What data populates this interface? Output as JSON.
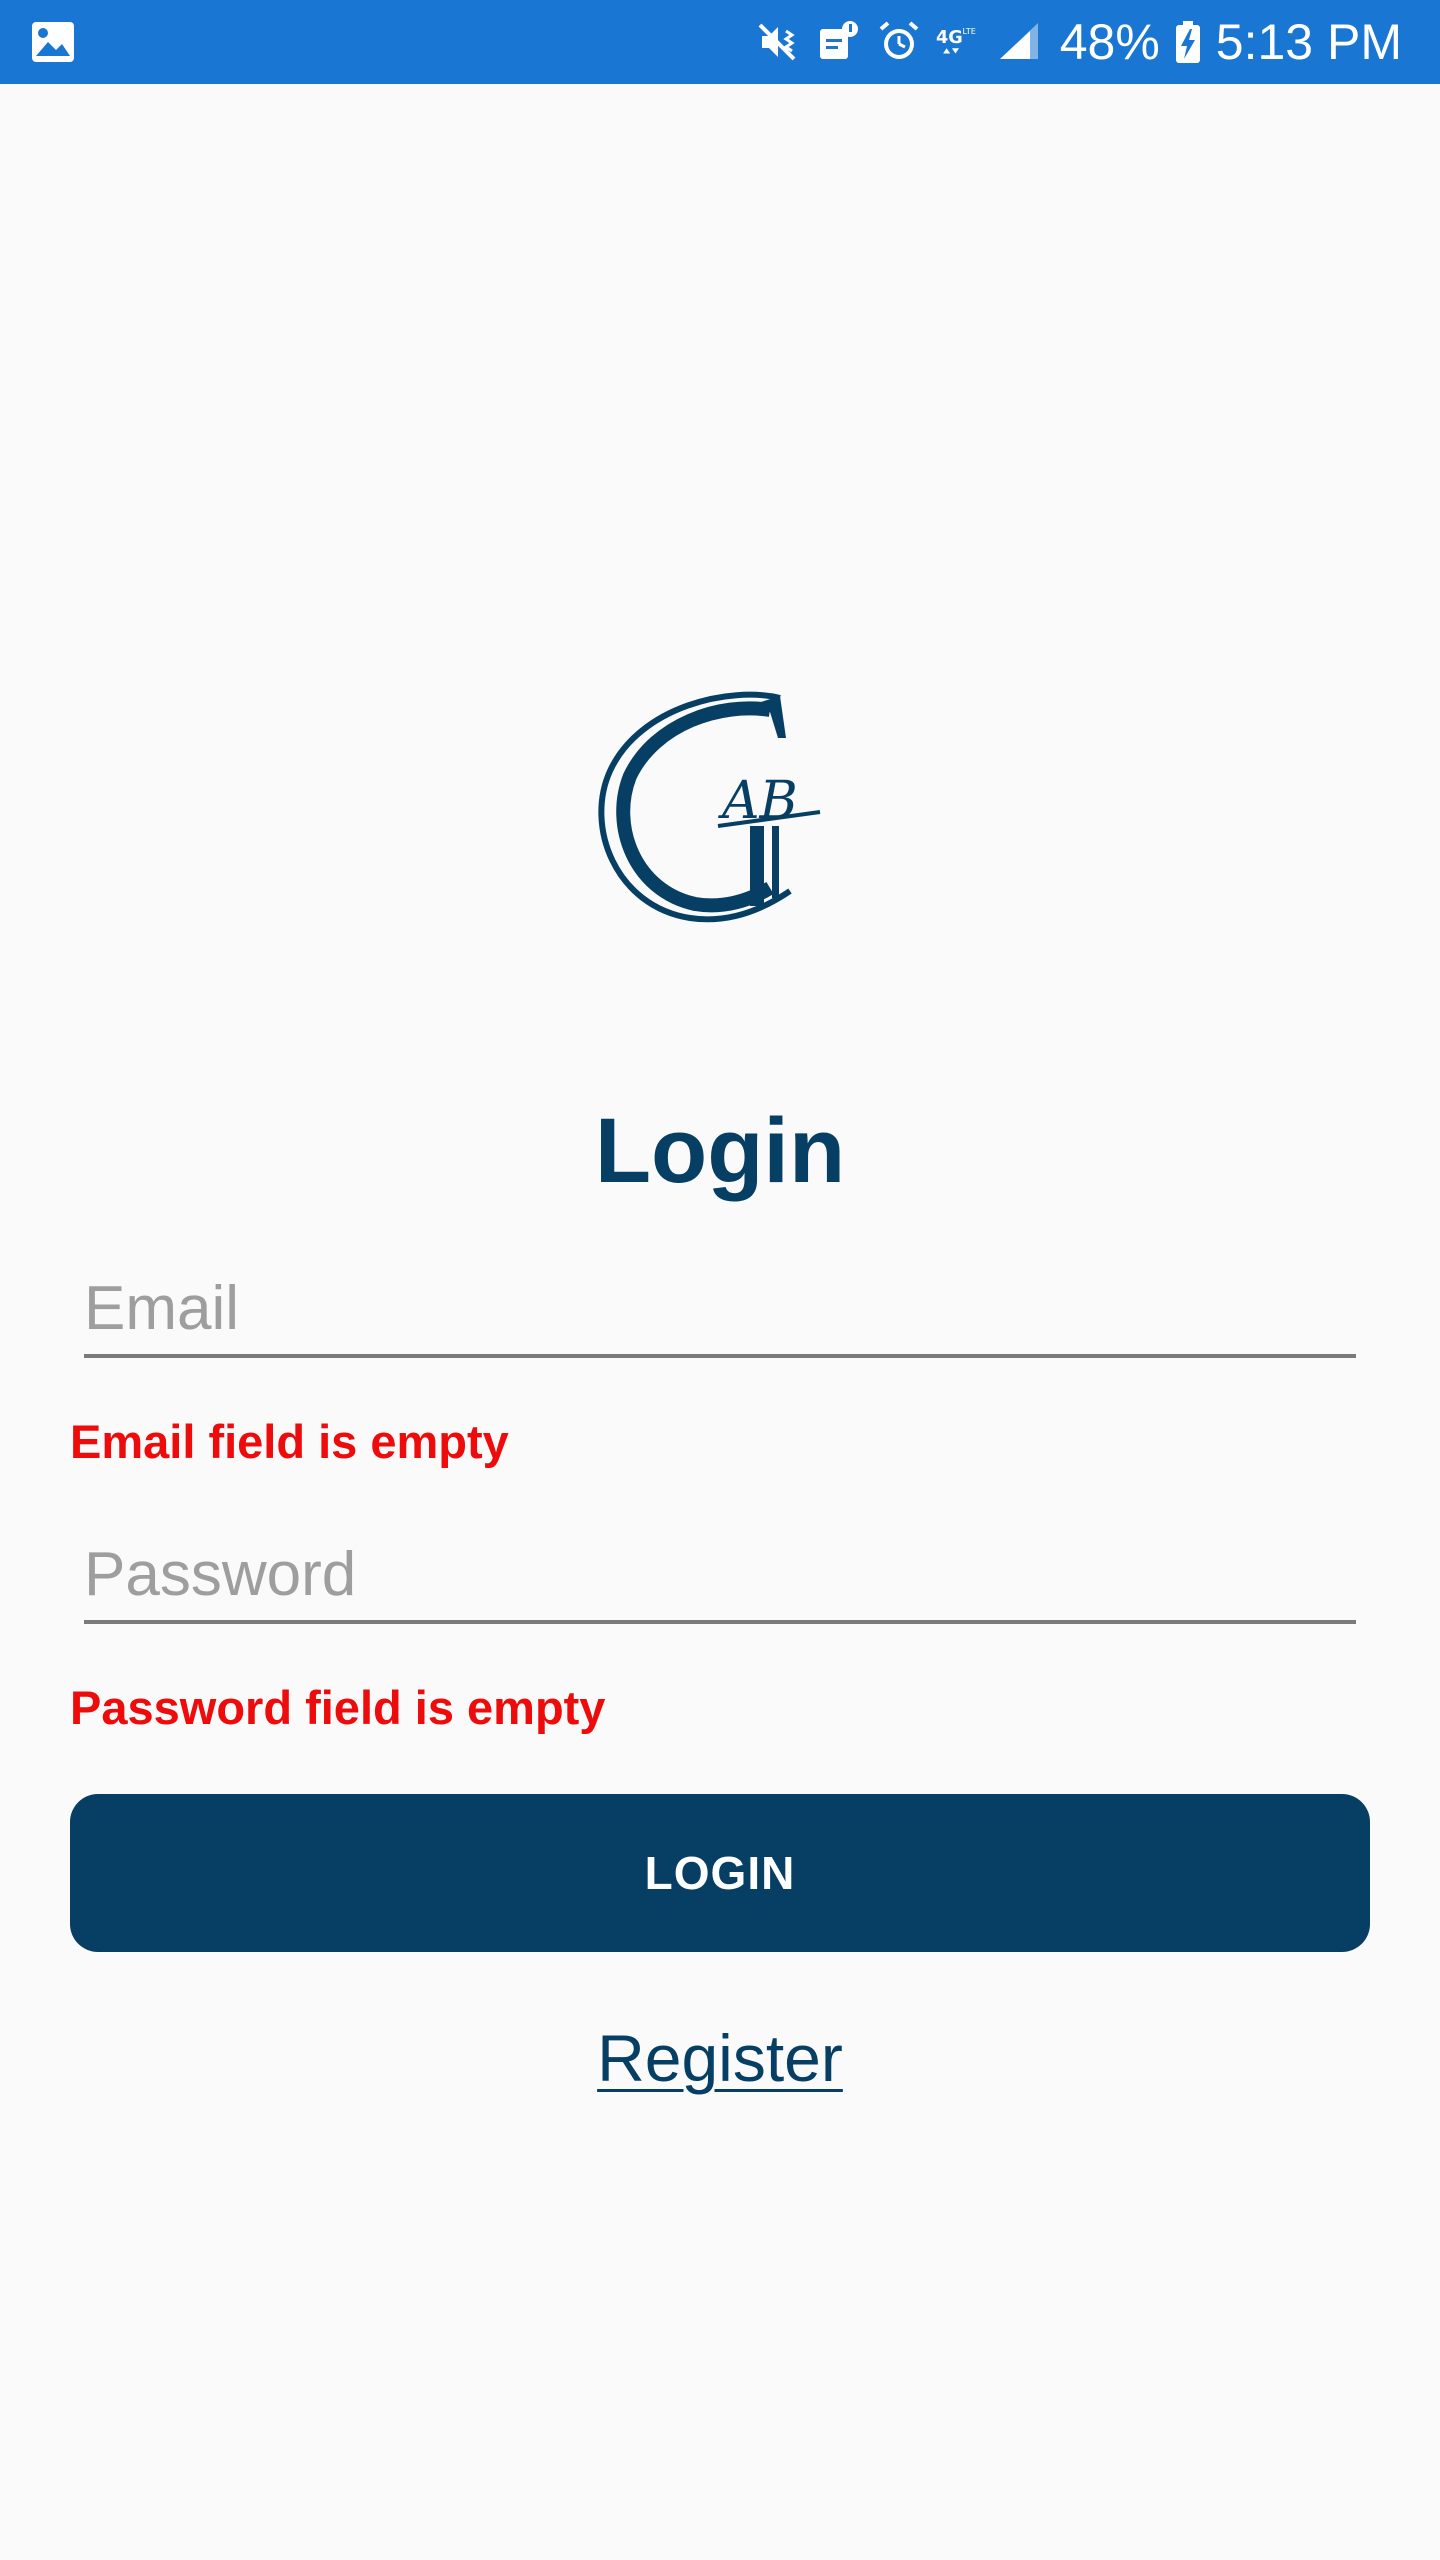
{
  "status_bar": {
    "left_icon": "image-icon",
    "icons": [
      "mute-vibrate-icon",
      "notification-icon",
      "alarm-icon",
      "4g-lte-icon",
      "signal-icon"
    ],
    "battery_percent": "48%",
    "battery_icon": "battery-charging-icon",
    "time": "5:13 PM",
    "background_color": "#1976d2"
  },
  "logo": {
    "letters": "GAB",
    "color": "#063f63"
  },
  "login": {
    "title": "Login",
    "email": {
      "placeholder": "Email",
      "value": "",
      "error": "Email field is empty"
    },
    "password": {
      "placeholder": "Password",
      "value": "",
      "error": "Password field is empty"
    },
    "login_button_label": "LOGIN",
    "register_link_label": "Register"
  },
  "colors": {
    "primary": "#063f63",
    "error": "#ee0b0b",
    "background": "#fafafa"
  }
}
